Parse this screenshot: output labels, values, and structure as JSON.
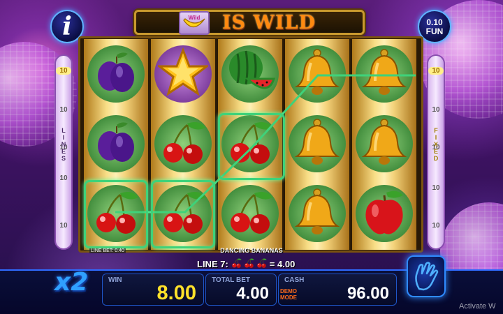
{
  "banner": {
    "title": "IS WILD",
    "badge_text": "Wild"
  },
  "top": {
    "info_label": "i",
    "denomination": "0.10",
    "mode": "FUN"
  },
  "side_left": {
    "label": "LINES",
    "numbers": [
      "10",
      "10",
      "10",
      "10",
      "10",
      "10",
      "10"
    ]
  },
  "side_right": {
    "label": "FIXED",
    "numbers": [
      "10",
      "10",
      "10",
      "10",
      "10",
      "10",
      "10"
    ]
  },
  "reels": [
    [
      "plum",
      "plum",
      "cherries"
    ],
    [
      "star",
      "cherries",
      "cherries"
    ],
    [
      "watermelon",
      "cherries",
      "cherries"
    ],
    [
      "bell",
      "bell",
      "bell"
    ],
    [
      "bell",
      "bell",
      "apple"
    ]
  ],
  "line_bet": "LINE BET: 0.40",
  "game_name": "DANCING BANANAS",
  "payline": {
    "label": "LINE 7:",
    "symbol": "cherries",
    "count": 3,
    "amount": "= 4.00"
  },
  "multiplier": "x2",
  "bottom": {
    "win_label": "WIN",
    "win_value": "8.00",
    "total_bet_label": "TOTAL BET",
    "total_bet_value": "4.00",
    "cash_label": "CASH",
    "cash_value": "96.00",
    "demo_line1": "DEMO",
    "demo_line2": "MODE"
  },
  "watermark": "Activate W",
  "colors": {
    "win_highlight": "#3fd27a",
    "win_value": "#ffe12a",
    "accent_blue": "#2f8bff"
  }
}
